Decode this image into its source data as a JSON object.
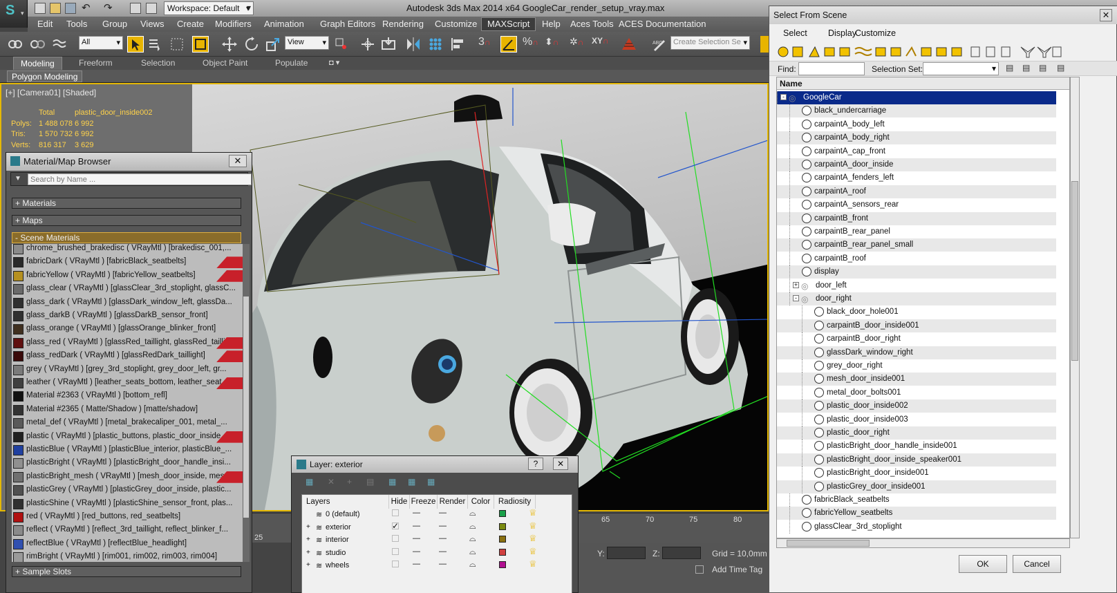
{
  "app": {
    "title": "Autodesk 3ds Max  2014 x64      GoogleCar_render_setup_vray.max",
    "workspace": "Workspace: Default"
  },
  "menu": [
    "Edit",
    "Tools",
    "Group",
    "Views",
    "Create",
    "Modifiers",
    "Animation",
    "Graph Editors",
    "Rendering",
    "Customize",
    "MAXScript",
    "Help",
    "Aces Tools",
    "ACES Documentation"
  ],
  "toolbar": {
    "filter": "All",
    "ref_coord": "View",
    "selection_set_placeholder": "Create Selection Se"
  },
  "ribbon": {
    "tabs": [
      "Modeling",
      "Freeform",
      "Selection",
      "Object Paint",
      "Populate"
    ],
    "panel": "Polygon Modeling"
  },
  "viewport": {
    "label": "[+] [Camera01] [Shaded]",
    "stats": {
      "header_total": "Total",
      "header_obj": "plastic_door_inside002",
      "polys_label": "Polys:",
      "polys_total": "1 488 078",
      "polys_obj": "6 992",
      "tris_label": "Tris:",
      "tris_total": "1 570 732",
      "tris_obj": "6 992",
      "verts_label": "Verts:",
      "verts_total": "816 317",
      "verts_obj": "3 629"
    },
    "timeline_ticks": [
      "25",
      "65",
      "70",
      "75",
      "80"
    ]
  },
  "material_browser": {
    "title": "Material/Map Browser",
    "search_placeholder": "Search by Name ...",
    "groups": [
      "+ Materials",
      "+ Maps",
      "- Scene Materials",
      "+ Sample Slots"
    ],
    "materials": [
      {
        "text": "chrome_brushed_brakedisc ( VRayMtl ) [brakedisc_001,...",
        "color": "#8a8a8a",
        "red": false
      },
      {
        "text": "fabricDark ( VRayMtl ) [fabricBlack_seatbelts]",
        "color": "#2a2a2a",
        "red": true
      },
      {
        "text": "fabricYellow ( VRayMtl ) [fabricYellow_seatbelts]",
        "color": "#b59020",
        "red": true
      },
      {
        "text": "glass_clear ( VRayMtl ) [glassClear_3rd_stoplight, glassC...",
        "color": "#6a6a6a",
        "red": false
      },
      {
        "text": "glass_dark ( VRayMtl ) [glassDark_window_left, glassDa...",
        "color": "#303030",
        "red": false
      },
      {
        "text": "glass_darkB ( VRayMtl ) [glassDarkB_sensor_front]",
        "color": "#303030",
        "red": false
      },
      {
        "text": "glass_orange ( VRayMtl ) [glassOrange_blinker_front]",
        "color": "#403020",
        "red": false
      },
      {
        "text": "glass_red ( VRayMtl ) [glassRed_taillight, glassRed_tailli...",
        "color": "#601010",
        "red": true
      },
      {
        "text": "glass_redDark ( VRayMtl ) [glassRedDark_taillight]",
        "color": "#3a0a0a",
        "red": true
      },
      {
        "text": "grey ( VRayMtl ) [grey_3rd_stoplight, grey_door_left, gr...",
        "color": "#7a7a7a",
        "red": false
      },
      {
        "text": "leather ( VRayMtl ) [leather_seats_bottom, leather_seat...",
        "color": "#404040",
        "red": true
      },
      {
        "text": "Material #2363 ( VRayMtl ) [bottom_refl]",
        "color": "#111111",
        "red": false
      },
      {
        "text": "Material #2365 ( Matte/Shadow ) [matte/shadow]",
        "color": "#333333",
        "red": false
      },
      {
        "text": "metal_def ( VRayMtl ) [metal_brakecaliper_001, metal_...",
        "color": "#5a5a5a",
        "red": false
      },
      {
        "text": "plastic ( VRayMtl ) [plastic_buttons, plastic_door_inside...",
        "color": "#202020",
        "red": true
      },
      {
        "text": "plasticBlue ( VRayMtl ) [plasticBlue_interior, plasticBlue_...",
        "color": "#2040a0",
        "red": false
      },
      {
        "text": "plasticBright ( VRayMtl ) [plasticBright_door_handle_insi...",
        "color": "#909090",
        "red": false
      },
      {
        "text": "plasticBright_mesh ( VRayMtl ) [mesh_door_inside, mes...",
        "color": "#707070",
        "red": true
      },
      {
        "text": "plasticGrey ( VRayMtl ) [plasticGrey_door_inside, plastic...",
        "color": "#505050",
        "red": false
      },
      {
        "text": "plasticShine ( VRayMtl ) [plasticShine_sensor_front, plas...",
        "color": "#303030",
        "red": false
      },
      {
        "text": "red ( VRayMtl ) [red_buttons, red_seatbelts]",
        "color": "#b01010",
        "red": false
      },
      {
        "text": "reflect ( VRayMtl ) [reflect_3rd_taillight, reflect_blinker_f...",
        "color": "#8a8a8a",
        "red": false
      },
      {
        "text": "reflectBlue ( VRayMtl ) [reflectBlue_headlight]",
        "color": "#3050b0",
        "red": false
      },
      {
        "text": "rimBright ( VRayMtl ) [rim001, rim002, rim003, rim004]",
        "color": "#9a9a9a",
        "red": false
      }
    ]
  },
  "layer_dialog": {
    "title": "Layer: exterior",
    "columns": [
      "Layers",
      "Hide",
      "Freeze",
      "Render",
      "Color",
      "Radiosity"
    ],
    "layers": [
      {
        "name": "0 (default)",
        "color": "#19a049",
        "expand": "",
        "check": ""
      },
      {
        "name": "exterior",
        "color": "#7a8a10",
        "expand": "+",
        "check": "✓"
      },
      {
        "name": "interior",
        "color": "#8a7010",
        "expand": "+",
        "check": ""
      },
      {
        "name": "studio",
        "color": "#d04040",
        "expand": "+",
        "check": ""
      },
      {
        "name": "wheels",
        "color": "#b01090",
        "expand": "+",
        "check": ""
      }
    ]
  },
  "scene_dialog": {
    "title": "Select From Scene",
    "menu": [
      "Select",
      "Display",
      "Customize"
    ],
    "find_label": "Find:",
    "selection_set_label": "Selection Set:",
    "column_name": "Name",
    "items": [
      {
        "name": "GoogleCar",
        "level": 0,
        "group": true,
        "sel": true,
        "expander": "-"
      },
      {
        "name": "black_undercarriage",
        "level": 1
      },
      {
        "name": "carpaintA_body_left",
        "level": 1
      },
      {
        "name": "carpaintA_body_right",
        "level": 1
      },
      {
        "name": "carpaintA_cap_front",
        "level": 1
      },
      {
        "name": "carpaintA_door_inside",
        "level": 1
      },
      {
        "name": "carpaintA_fenders_left",
        "level": 1
      },
      {
        "name": "carpaintA_roof",
        "level": 1
      },
      {
        "name": "carpaintA_sensors_rear",
        "level": 1
      },
      {
        "name": "carpaintB_front",
        "level": 1
      },
      {
        "name": "carpaintB_rear_panel",
        "level": 1
      },
      {
        "name": "carpaintB_rear_panel_small",
        "level": 1
      },
      {
        "name": "carpaintB_roof",
        "level": 1
      },
      {
        "name": "display",
        "level": 1
      },
      {
        "name": "door_left",
        "level": 1,
        "group": true,
        "expander": "+"
      },
      {
        "name": "door_right",
        "level": 1,
        "group": true,
        "expander": "-"
      },
      {
        "name": "black_door_hole001",
        "level": 2
      },
      {
        "name": "carpaintB_door_inside001",
        "level": 2
      },
      {
        "name": "carpaintB_door_right",
        "level": 2
      },
      {
        "name": "glassDark_window_right",
        "level": 2
      },
      {
        "name": "grey_door_right",
        "level": 2
      },
      {
        "name": "mesh_door_inside001",
        "level": 2
      },
      {
        "name": "metal_door_bolts001",
        "level": 2
      },
      {
        "name": "plastic_door_inside002",
        "level": 2
      },
      {
        "name": "plastic_door_inside003",
        "level": 2
      },
      {
        "name": "plastic_door_right",
        "level": 2
      },
      {
        "name": "plasticBright_door_handle_inside001",
        "level": 2
      },
      {
        "name": "plasticBright_door_inside_speaker001",
        "level": 2
      },
      {
        "name": "plasticBright_door_inside001",
        "level": 2
      },
      {
        "name": "plasticGrey_door_inside001",
        "level": 2
      },
      {
        "name": "fabricBlack_seatbelts",
        "level": 1
      },
      {
        "name": "fabricYellow_seatbelts",
        "level": 1
      },
      {
        "name": "glassClear_3rd_stoplight",
        "level": 1
      }
    ],
    "ok": "OK",
    "cancel": "Cancel"
  },
  "status": {
    "y_label": "Y:",
    "z_label": "Z:",
    "grid": "Grid = 10,0mm",
    "add_time_tag": "Add Time Tag"
  }
}
